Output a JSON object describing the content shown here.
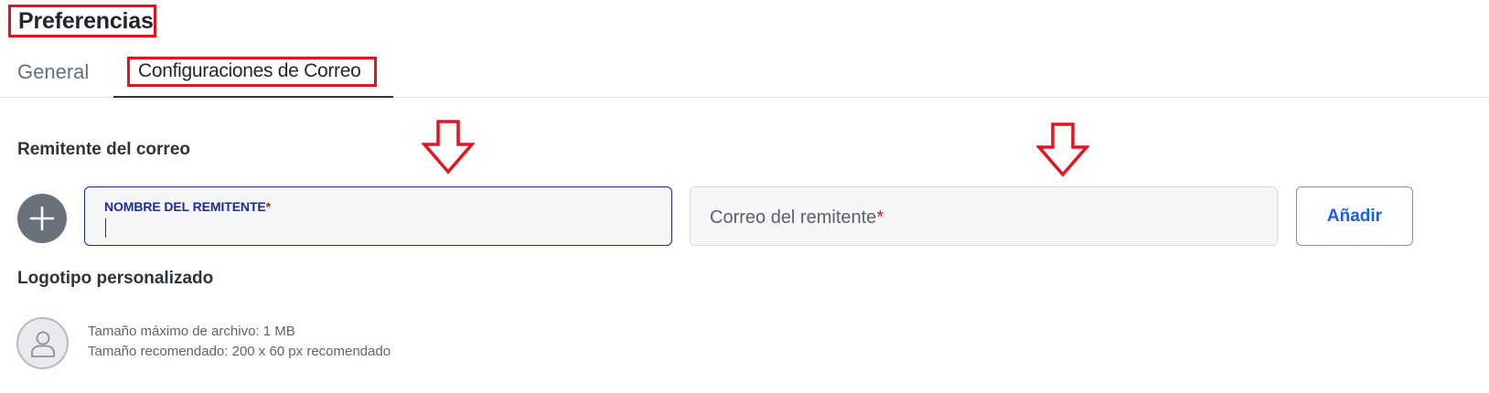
{
  "title": "Preferencias",
  "tabs": {
    "general": "General",
    "mail_settings": "Configuraciones de Correo"
  },
  "sender": {
    "heading": "Remitente del correo",
    "name_label": "NOMBRE DEL REMITENTE",
    "name_value": "",
    "required_mark": "*",
    "email_placeholder": "Correo del remitente",
    "add_button": "Añadir"
  },
  "logo": {
    "heading": "Logotipo personalizado",
    "max_size": "Tamaño máximo de archivo: 1 MB",
    "recommended_size": "Tamaño recomendado: 200 x 60 px recomendado"
  },
  "colors": {
    "annotation_red": "#e3141f",
    "focus_blue": "#1f2a98",
    "button_blue": "#1b5ee6"
  },
  "icons": [
    "plus-icon",
    "user-icon",
    "down-arrow-icon"
  ]
}
